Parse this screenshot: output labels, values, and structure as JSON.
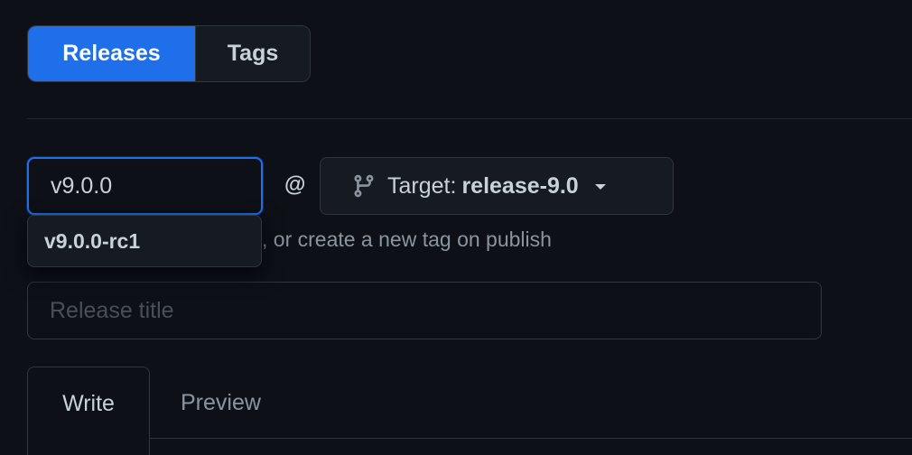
{
  "release_tabs": {
    "releases_label": "Releases",
    "tags_label": "Tags",
    "active": "Releases"
  },
  "tag_picker": {
    "value": "v9.0.0",
    "at_symbol": "@",
    "target_prefix": "Target:",
    "target_branch": "release-9.0",
    "hint_text": ", or create a new tag on publish",
    "suggestions": [
      "v9.0.0-rc1"
    ]
  },
  "release_title": {
    "placeholder": "Release title",
    "value": ""
  },
  "editor_tabs": {
    "write_label": "Write",
    "preview_label": "Preview",
    "active": "Write"
  },
  "colors": {
    "background": "#0d1117",
    "accent": "#1f6feb",
    "border": "#30363d",
    "text": "#c9d1d9",
    "muted": "#8b949e"
  },
  "icons": {
    "target": "git-branch-icon",
    "dropdown": "triangle-down-icon"
  }
}
